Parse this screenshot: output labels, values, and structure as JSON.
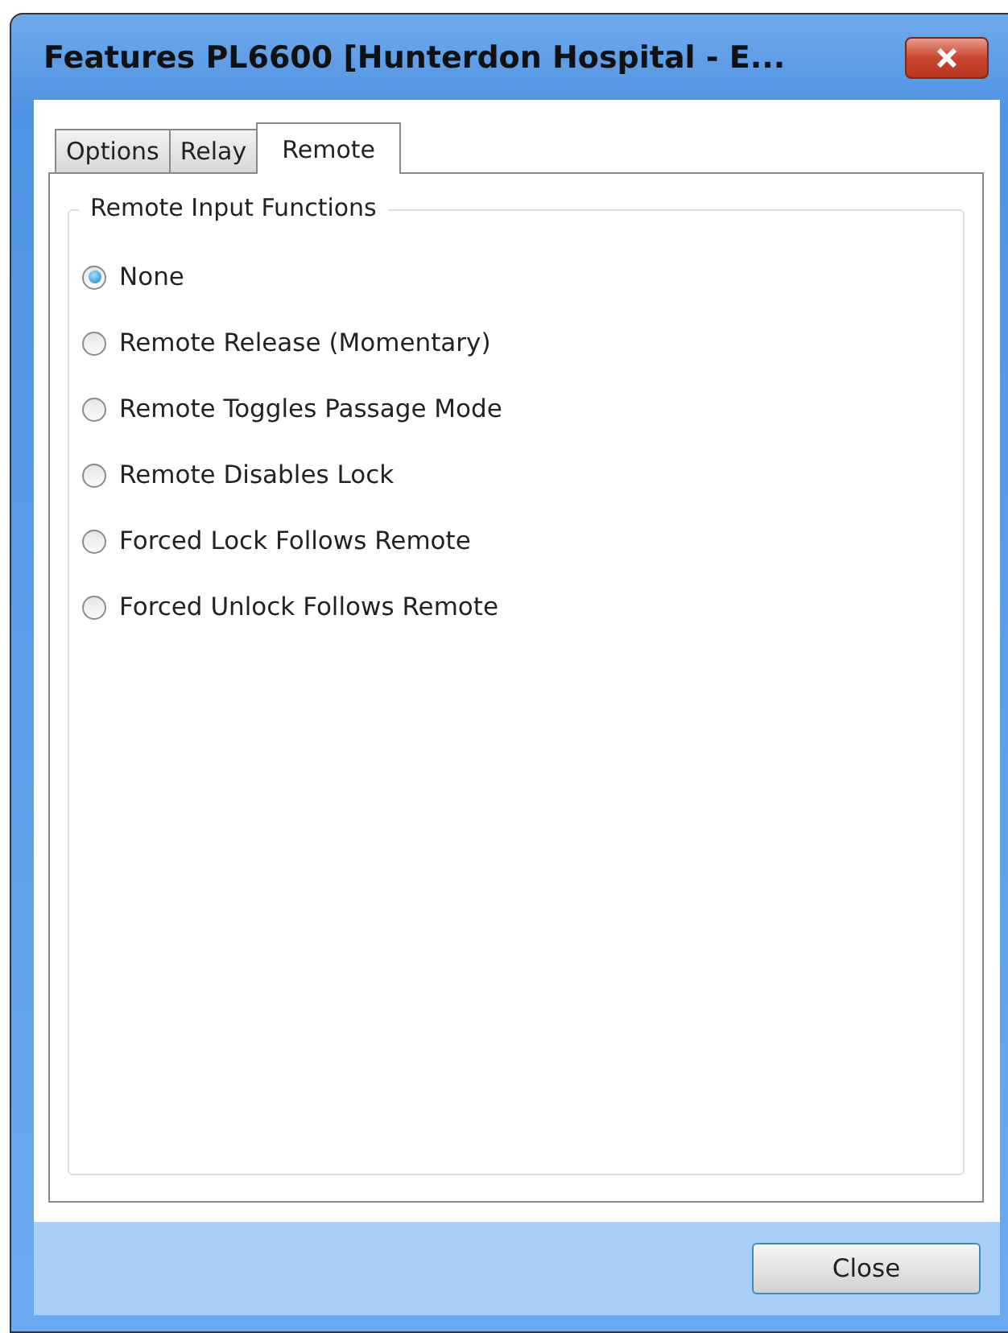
{
  "window": {
    "title": "Features PL6600 [Hunterdon Hospital - E..."
  },
  "tabs": [
    {
      "label": "Options",
      "selected": false
    },
    {
      "label": "Relay",
      "selected": false
    },
    {
      "label": "Remote",
      "selected": true
    }
  ],
  "group": {
    "title": "Remote Input Functions",
    "options": [
      {
        "label": "None",
        "selected": true
      },
      {
        "label": "Remote Release (Momentary)",
        "selected": false
      },
      {
        "label": "Remote Toggles Passage Mode",
        "selected": false
      },
      {
        "label": "Remote Disables Lock",
        "selected": false
      },
      {
        "label": "Forced Lock Follows Remote",
        "selected": false
      },
      {
        "label": "Forced Unlock Follows Remote",
        "selected": false
      }
    ]
  },
  "buttons": [
    {
      "label": "Close"
    }
  ]
}
